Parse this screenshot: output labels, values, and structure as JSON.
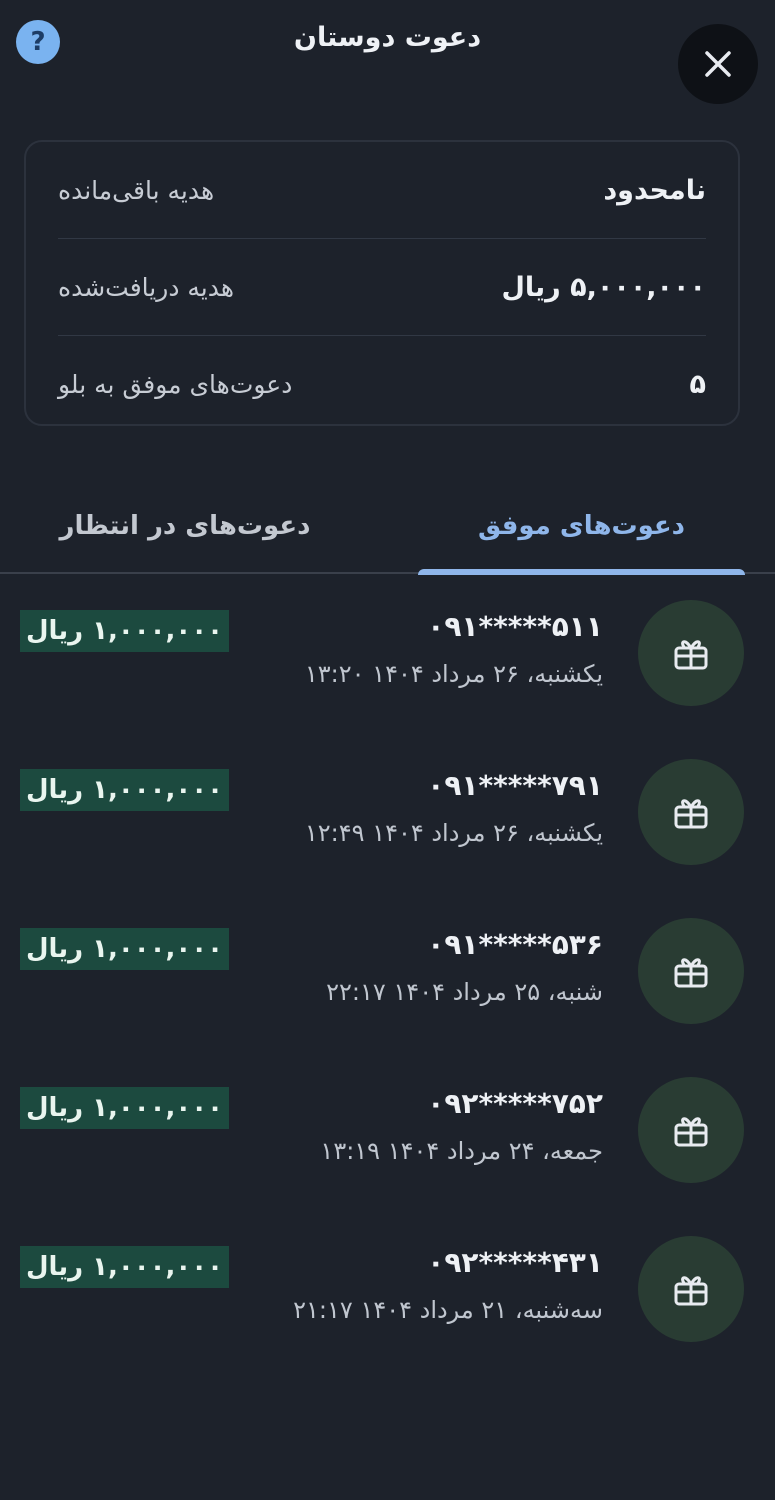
{
  "header": {
    "title": "دعوت دوستان",
    "help_label": "?"
  },
  "summary": [
    {
      "label": "هدیه باقی‌مانده",
      "value": "نامحدود"
    },
    {
      "label": "هدیه دریافت‌شده",
      "value": "۵,۰۰۰,۰۰۰ ریال"
    },
    {
      "label": "دعوت‌های موفق به بلو",
      "value": "۵"
    }
  ],
  "tabs": {
    "successful": "دعوت‌های موفق",
    "pending": "دعوت‌های در انتظار",
    "active": "successful"
  },
  "invites": [
    {
      "phone": "۰۹۱*****۵۱۱",
      "date": "یکشنبه، ۲۶ مرداد ۱۴۰۴ ۱۳:۲۰",
      "reward": "۱,۰۰۰,۰۰۰ ریال"
    },
    {
      "phone": "۰۹۱*****۷۹۱",
      "date": "یکشنبه، ۲۶ مرداد ۱۴۰۴ ۱۲:۴۹",
      "reward": "۱,۰۰۰,۰۰۰ ریال"
    },
    {
      "phone": "۰۹۱*****۵۳۶",
      "date": "شنبه، ۲۵ مرداد ۱۴۰۴ ۲۲:۱۷",
      "reward": "۱,۰۰۰,۰۰۰ ریال"
    },
    {
      "phone": "۰۹۲*****۷۵۲",
      "date": "جمعه، ۲۴ مرداد ۱۴۰۴ ۱۳:۱۹",
      "reward": "۱,۰۰۰,۰۰۰ ریال"
    },
    {
      "phone": "۰۹۲*****۴۳۱",
      "date": "سه‌شنبه، ۲۱ مرداد ۱۴۰۴ ۲۱:۱۷",
      "reward": "۱,۰۰۰,۰۰۰ ریال"
    }
  ],
  "icons": {
    "help": "question-icon",
    "close": "close-icon",
    "invite": "gift-icon"
  },
  "colors": {
    "background": "#1d222b",
    "accent": "#8fb6ea",
    "reward_badge": "#1c4a3f",
    "gift_avatar": "#293c33",
    "help_button": "#7ab3f0"
  }
}
